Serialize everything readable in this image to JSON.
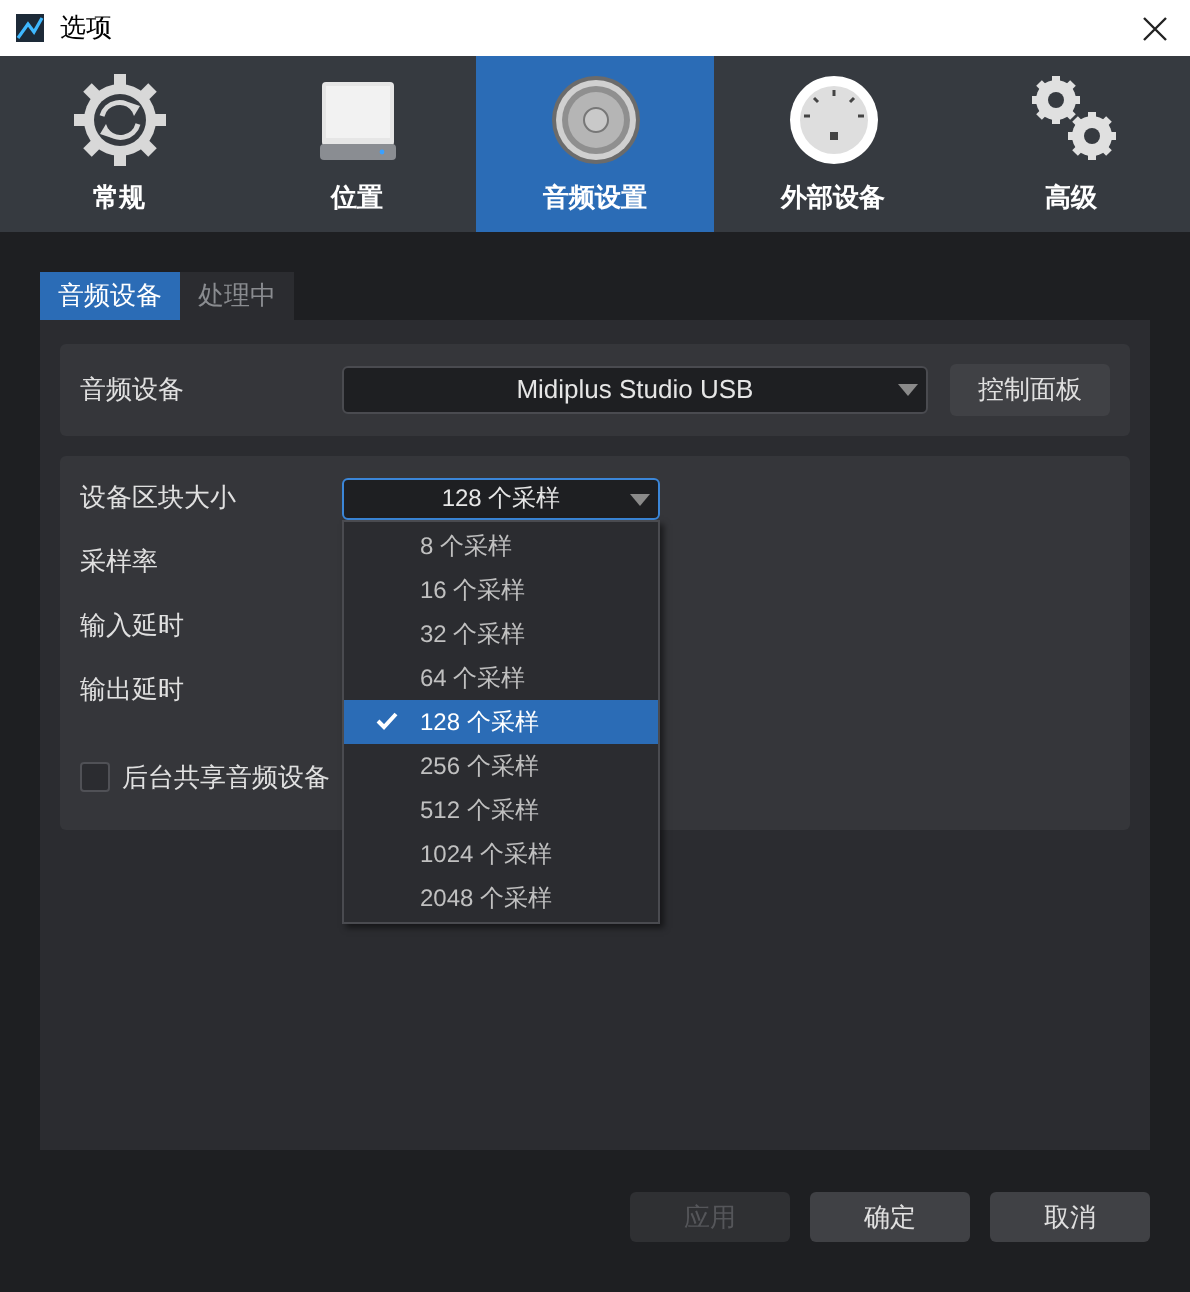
{
  "window": {
    "title": "选项"
  },
  "tabs": [
    {
      "label": "常规",
      "kind": "general",
      "selected": false
    },
    {
      "label": "位置",
      "kind": "location",
      "selected": false
    },
    {
      "label": "音频设置",
      "kind": "audio",
      "selected": true
    },
    {
      "label": "外部设备",
      "kind": "external",
      "selected": false
    },
    {
      "label": "高级",
      "kind": "advanced",
      "selected": false
    }
  ],
  "sub_tabs": [
    {
      "label": "音频设备",
      "selected": true
    },
    {
      "label": "处理中",
      "selected": false
    }
  ],
  "audio_device": {
    "label": "音频设备",
    "value": "Midiplus Studio USB",
    "button": "控制面板"
  },
  "settings": {
    "rows": [
      {
        "label": "设备区块大小"
      },
      {
        "label": "采样率"
      },
      {
        "label": "输入延时"
      },
      {
        "label": "输出延时"
      }
    ],
    "block_size": {
      "value": "128 个采样",
      "expanded": true,
      "options": [
        {
          "label": "8 个采样",
          "selected": false
        },
        {
          "label": "16 个采样",
          "selected": false
        },
        {
          "label": "32 个采样",
          "selected": false
        },
        {
          "label": "64 个采样",
          "selected": false
        },
        {
          "label": "128 个采样",
          "selected": true
        },
        {
          "label": "256 个采样",
          "selected": false
        },
        {
          "label": "512 个采样",
          "selected": false
        },
        {
          "label": "1024 个采样",
          "selected": false
        },
        {
          "label": "2048 个采样",
          "selected": false
        }
      ]
    },
    "share_checkbox": {
      "label": "后台共享音频设备",
      "checked": false
    }
  },
  "buttons": [
    {
      "label": "应用",
      "disabled": true
    },
    {
      "label": "确定",
      "disabled": false
    },
    {
      "label": "取消",
      "disabled": false
    }
  ]
}
